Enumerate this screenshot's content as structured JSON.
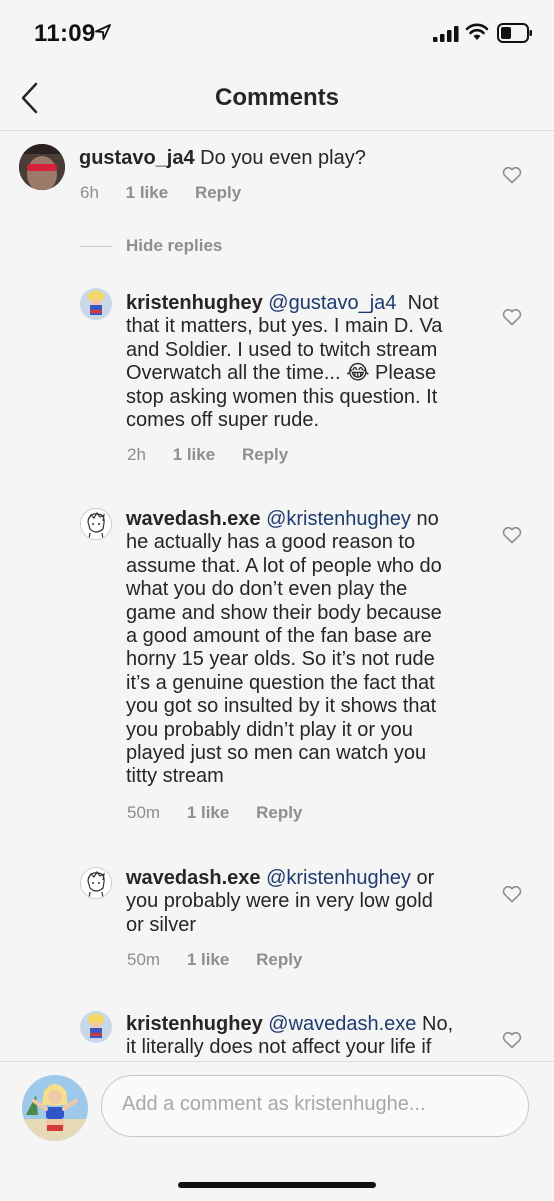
{
  "status_bar": {
    "time": "11:09"
  },
  "header": {
    "title": "Comments"
  },
  "comments": [
    {
      "username": "gustavo_ja4",
      "text": "Do you even play?",
      "time": "6h",
      "likes": "1 like",
      "reply_label": "Reply"
    },
    {
      "username": "kristenhughey",
      "mention": "@gustavo_ja4",
      "text_lines": [
        "Not",
        "that it matters, but yes.  I main D. Va",
        "and Soldier.  I used to twitch stream",
        "Overwatch all the time...",
        "Please",
        "stop asking women this question.  It",
        "comes off super rude."
      ],
      "emoji": "😂",
      "time": "2h",
      "likes": "1 like",
      "reply_label": "Reply"
    },
    {
      "username": "wavedash.exe",
      "mention": "@kristenhughey",
      "text_lines": [
        "no",
        "he actually has a good reason to",
        "assume that. A lot of people who do",
        "what you do don’t even play the",
        "game and show their body because",
        "a good amount of the fan base are",
        "horny 15 year olds. So it’s not rude",
        "it’s a genuine question the fact that",
        "you got so insulted by it shows that",
        "you probably didn’t play it or you",
        "played just so men can watch you",
        "titty stream"
      ],
      "time": "50m",
      "likes": "1 like",
      "reply_label": "Reply"
    },
    {
      "username": "wavedash.exe",
      "mention": "@kristenhughey",
      "text_lines": [
        "or",
        "you probably were in very low gold",
        "or silver"
      ],
      "time": "50m",
      "likes": "1 like",
      "reply_label": "Reply"
    },
    {
      "username": "kristenhughey",
      "mention": "@wavedash.exe",
      "text_lines": [
        "No,",
        "it literally does not affect your life if"
      ]
    }
  ],
  "hide_replies_label": "Hide replies",
  "composer": {
    "placeholder": "Add a comment as kristenhughe..."
  },
  "colors": {
    "background": "#f5f5f5",
    "text": "#262626",
    "secondary": "#8e8e8e",
    "mention": "#1e3b6e",
    "divider": "#dbdbdb"
  },
  "icons": [
    "location-arrow-icon",
    "signal-icon",
    "wifi-icon",
    "battery-icon",
    "back-chevron-icon",
    "heart-icon"
  ]
}
